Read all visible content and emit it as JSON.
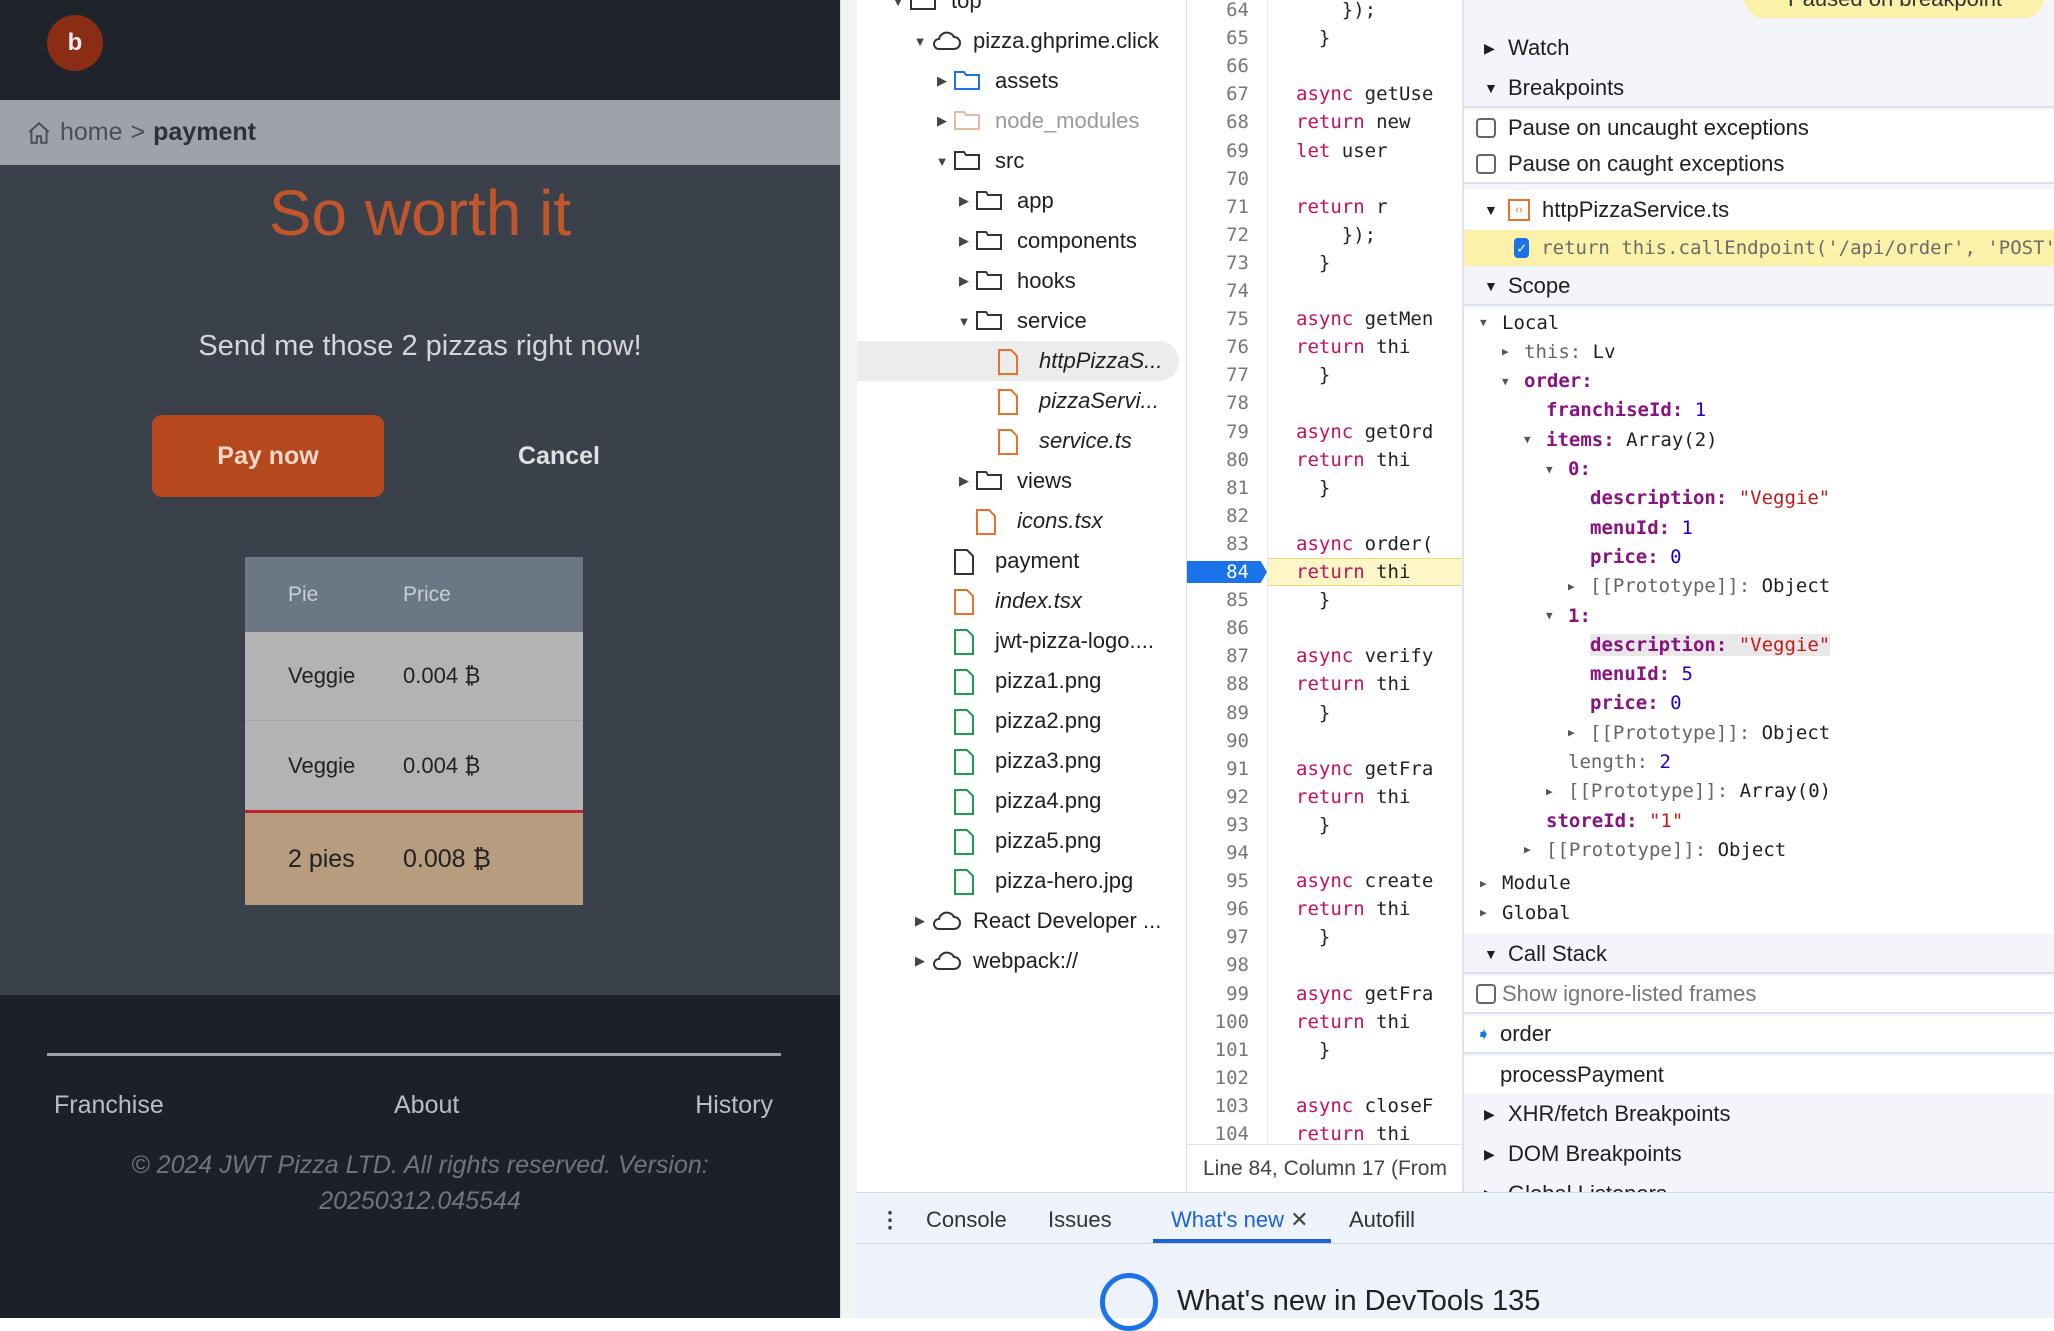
{
  "app": {
    "avatar": "b",
    "breadcrumb": {
      "home": "home",
      "sep": ">",
      "current": "payment"
    },
    "title": "So worth it",
    "subtitle": "Send me those 2 pizzas right now!",
    "pay_label": "Pay now",
    "cancel_label": "Cancel",
    "table": {
      "headers": [
        "Pie",
        "Price"
      ],
      "rows": [
        [
          "Veggie",
          "0.004 ₿"
        ],
        [
          "Veggie",
          "0.004 ₿"
        ]
      ],
      "total": [
        "2 pies",
        "0.008 ₿"
      ]
    },
    "footer": {
      "links": [
        "Franchise",
        "About",
        "History"
      ],
      "copyright": "© 2024 JWT Pizza LTD. All rights reserved. Version: 20250312.045544"
    }
  },
  "tree": [
    {
      "label": "top",
      "depth": -1,
      "type": "frame",
      "arrow": "open"
    },
    {
      "label": "pizza.ghprime.click",
      "depth": 0,
      "type": "cloud",
      "arrow": "open"
    },
    {
      "label": "assets",
      "depth": 1,
      "type": "folder-blue",
      "arrow": "closed"
    },
    {
      "label": "node_modules",
      "depth": 1,
      "type": "folder-faded",
      "arrow": "closed"
    },
    {
      "label": "src",
      "depth": 1,
      "type": "folder",
      "arrow": "open"
    },
    {
      "label": "app",
      "depth": 2,
      "type": "folder",
      "arrow": "closed"
    },
    {
      "label": "components",
      "depth": 2,
      "type": "folder",
      "arrow": "closed"
    },
    {
      "label": "hooks",
      "depth": 2,
      "type": "folder",
      "arrow": "closed"
    },
    {
      "label": "service",
      "depth": 2,
      "type": "folder",
      "arrow": "open"
    },
    {
      "label": "httpPizzaS...",
      "depth": 3,
      "type": "file-orange",
      "italic": true,
      "selected": true
    },
    {
      "label": "pizzaServi...",
      "depth": 3,
      "type": "file-orange",
      "italic": true
    },
    {
      "label": "service.ts",
      "depth": 3,
      "type": "file-orange",
      "italic": true
    },
    {
      "label": "views",
      "depth": 2,
      "type": "folder",
      "arrow": "closed"
    },
    {
      "label": "icons.tsx",
      "depth": 2,
      "type": "file-orange",
      "italic": true
    },
    {
      "label": "payment",
      "depth": 1,
      "type": "file"
    },
    {
      "label": "index.tsx",
      "depth": 1,
      "type": "file-orange",
      "italic": true
    },
    {
      "label": "jwt-pizza-logo....",
      "depth": 1,
      "type": "file-green"
    },
    {
      "label": "pizza1.png",
      "depth": 1,
      "type": "file-green"
    },
    {
      "label": "pizza2.png",
      "depth": 1,
      "type": "file-green"
    },
    {
      "label": "pizza3.png",
      "depth": 1,
      "type": "file-green"
    },
    {
      "label": "pizza4.png",
      "depth": 1,
      "type": "file-green"
    },
    {
      "label": "pizza5.png",
      "depth": 1,
      "type": "file-green"
    },
    {
      "label": "pizza-hero.jpg",
      "depth": 1,
      "type": "file-green"
    },
    {
      "label": "React Developer ...",
      "depth": 0,
      "type": "cloud",
      "arrow": "closed"
    },
    {
      "label": "webpack://",
      "depth": 0,
      "type": "cloud",
      "arrow": "closed"
    }
  ],
  "code": {
    "first_line": 64,
    "current_line": 84,
    "lines": [
      [
        "",
        "    });"
      ],
      [
        "",
        "  }"
      ],
      [
        "",
        ""
      ],
      [
        "async",
        " getUse"
      ],
      [
        "return",
        " new"
      ],
      [
        "let",
        " user"
      ],
      [
        "",
        ""
      ],
      [
        "return",
        " r"
      ],
      [
        "",
        "    });"
      ],
      [
        "",
        "  }"
      ],
      [
        "",
        ""
      ],
      [
        "async",
        " getMen"
      ],
      [
        "return",
        " thi"
      ],
      [
        "",
        "  }"
      ],
      [
        "",
        ""
      ],
      [
        "async",
        " getOrd"
      ],
      [
        "return",
        " thi"
      ],
      [
        "",
        "  }"
      ],
      [
        "",
        ""
      ],
      [
        "async",
        " order("
      ],
      [
        "return",
        " thi"
      ],
      [
        "",
        "  }"
      ],
      [
        "",
        ""
      ],
      [
        "async",
        " verify"
      ],
      [
        "return",
        " thi"
      ],
      [
        "",
        "  }"
      ],
      [
        "",
        ""
      ],
      [
        "async",
        " getFra"
      ],
      [
        "return",
        " thi"
      ],
      [
        "",
        "  }"
      ],
      [
        "",
        ""
      ],
      [
        "async",
        " create"
      ],
      [
        "return",
        " thi"
      ],
      [
        "",
        "  }"
      ],
      [
        "",
        ""
      ],
      [
        "async",
        " getFra"
      ],
      [
        "return",
        " thi"
      ],
      [
        "",
        "  }"
      ],
      [
        "",
        ""
      ],
      [
        "async",
        " closeF"
      ],
      [
        "return",
        " thi"
      ]
    ],
    "status": "Line 84, Column 17  (From"
  },
  "debugger": {
    "paused_label": "Paused on breakpoint",
    "watch": "Watch",
    "breakpoints": "Breakpoints",
    "pause_uncaught": "Pause on uncaught exceptions",
    "pause_caught": "Pause on caught exceptions",
    "bp_file": "httpPizzaService.ts",
    "bp_code": "return this.callEndpoint('/api/order', 'POST'",
    "scope": "Scope",
    "scope_rows": [
      {
        "indent": 0,
        "arrow": "▼",
        "key": "Local",
        "cls": "plain"
      },
      {
        "indent": 1,
        "arrow": "▶",
        "key": "this",
        "val": "Lv",
        "cls": "dim"
      },
      {
        "indent": 1,
        "arrow": "▼",
        "key": "order",
        "val": "",
        "cls": "k"
      },
      {
        "indent": 2,
        "key": "franchiseId",
        "val": "1",
        "vcls": "vn",
        "cls": "k"
      },
      {
        "indent": 2,
        "arrow": "▼",
        "key": "items",
        "val": "Array(2)",
        "cls": "k"
      },
      {
        "indent": 3,
        "arrow": "▼",
        "key": "0",
        "val": "",
        "cls": "k"
      },
      {
        "indent": 4,
        "key": "description",
        "val": "\"Veggie\"",
        "vcls": "vs",
        "cls": "k"
      },
      {
        "indent": 4,
        "key": "menuId",
        "val": "1",
        "vcls": "vn",
        "cls": "k"
      },
      {
        "indent": 4,
        "key": "price",
        "val": "0",
        "vcls": "vn",
        "cls": "k"
      },
      {
        "indent": 4,
        "arrow": "▶",
        "key": "[[Prototype]]",
        "val": "Object",
        "cls": "kp"
      },
      {
        "indent": 3,
        "arrow": "▼",
        "key": "1",
        "val": "",
        "cls": "k"
      },
      {
        "indent": 4,
        "key": "description",
        "val": "\"Veggie\"",
        "vcls": "vs",
        "cls": "k",
        "hl": true
      },
      {
        "indent": 4,
        "key": "menuId",
        "val": "5",
        "vcls": "vn",
        "cls": "k"
      },
      {
        "indent": 4,
        "key": "price",
        "val": "0",
        "vcls": "vn",
        "cls": "k"
      },
      {
        "indent": 4,
        "arrow": "▶",
        "key": "[[Prototype]]",
        "val": "Object",
        "cls": "kp"
      },
      {
        "indent": 3,
        "key": "length",
        "val": "2",
        "vcls": "vn",
        "cls": "kp"
      },
      {
        "indent": 3,
        "arrow": "▶",
        "key": "[[Prototype]]",
        "val": "Array(0)",
        "cls": "kp"
      },
      {
        "indent": 2,
        "key": "storeId",
        "val": "\"1\"",
        "vcls": "vs",
        "cls": "k"
      },
      {
        "indent": 2,
        "arrow": "▶",
        "key": "[[Prototype]]",
        "val": "Object",
        "cls": "kp"
      },
      {
        "indent": 0,
        "arrow": "▶",
        "key": "Module",
        "cls": "plain"
      },
      {
        "indent": 0,
        "arrow": "▶",
        "key": "Global",
        "cls": "plain"
      }
    ],
    "call_stack": "Call Stack",
    "show_ignored": "Show ignore-listed frames",
    "frames": [
      "order",
      "processPayment"
    ],
    "xhr": "XHR/fetch Breakpoints",
    "dom": "DOM Breakpoints",
    "global": "Global Listeners"
  },
  "drawer": {
    "tabs": [
      "Console",
      "Issues",
      "What's new",
      "Autofill"
    ],
    "active": "What's new",
    "headline": "What's new in DevTools 135"
  }
}
